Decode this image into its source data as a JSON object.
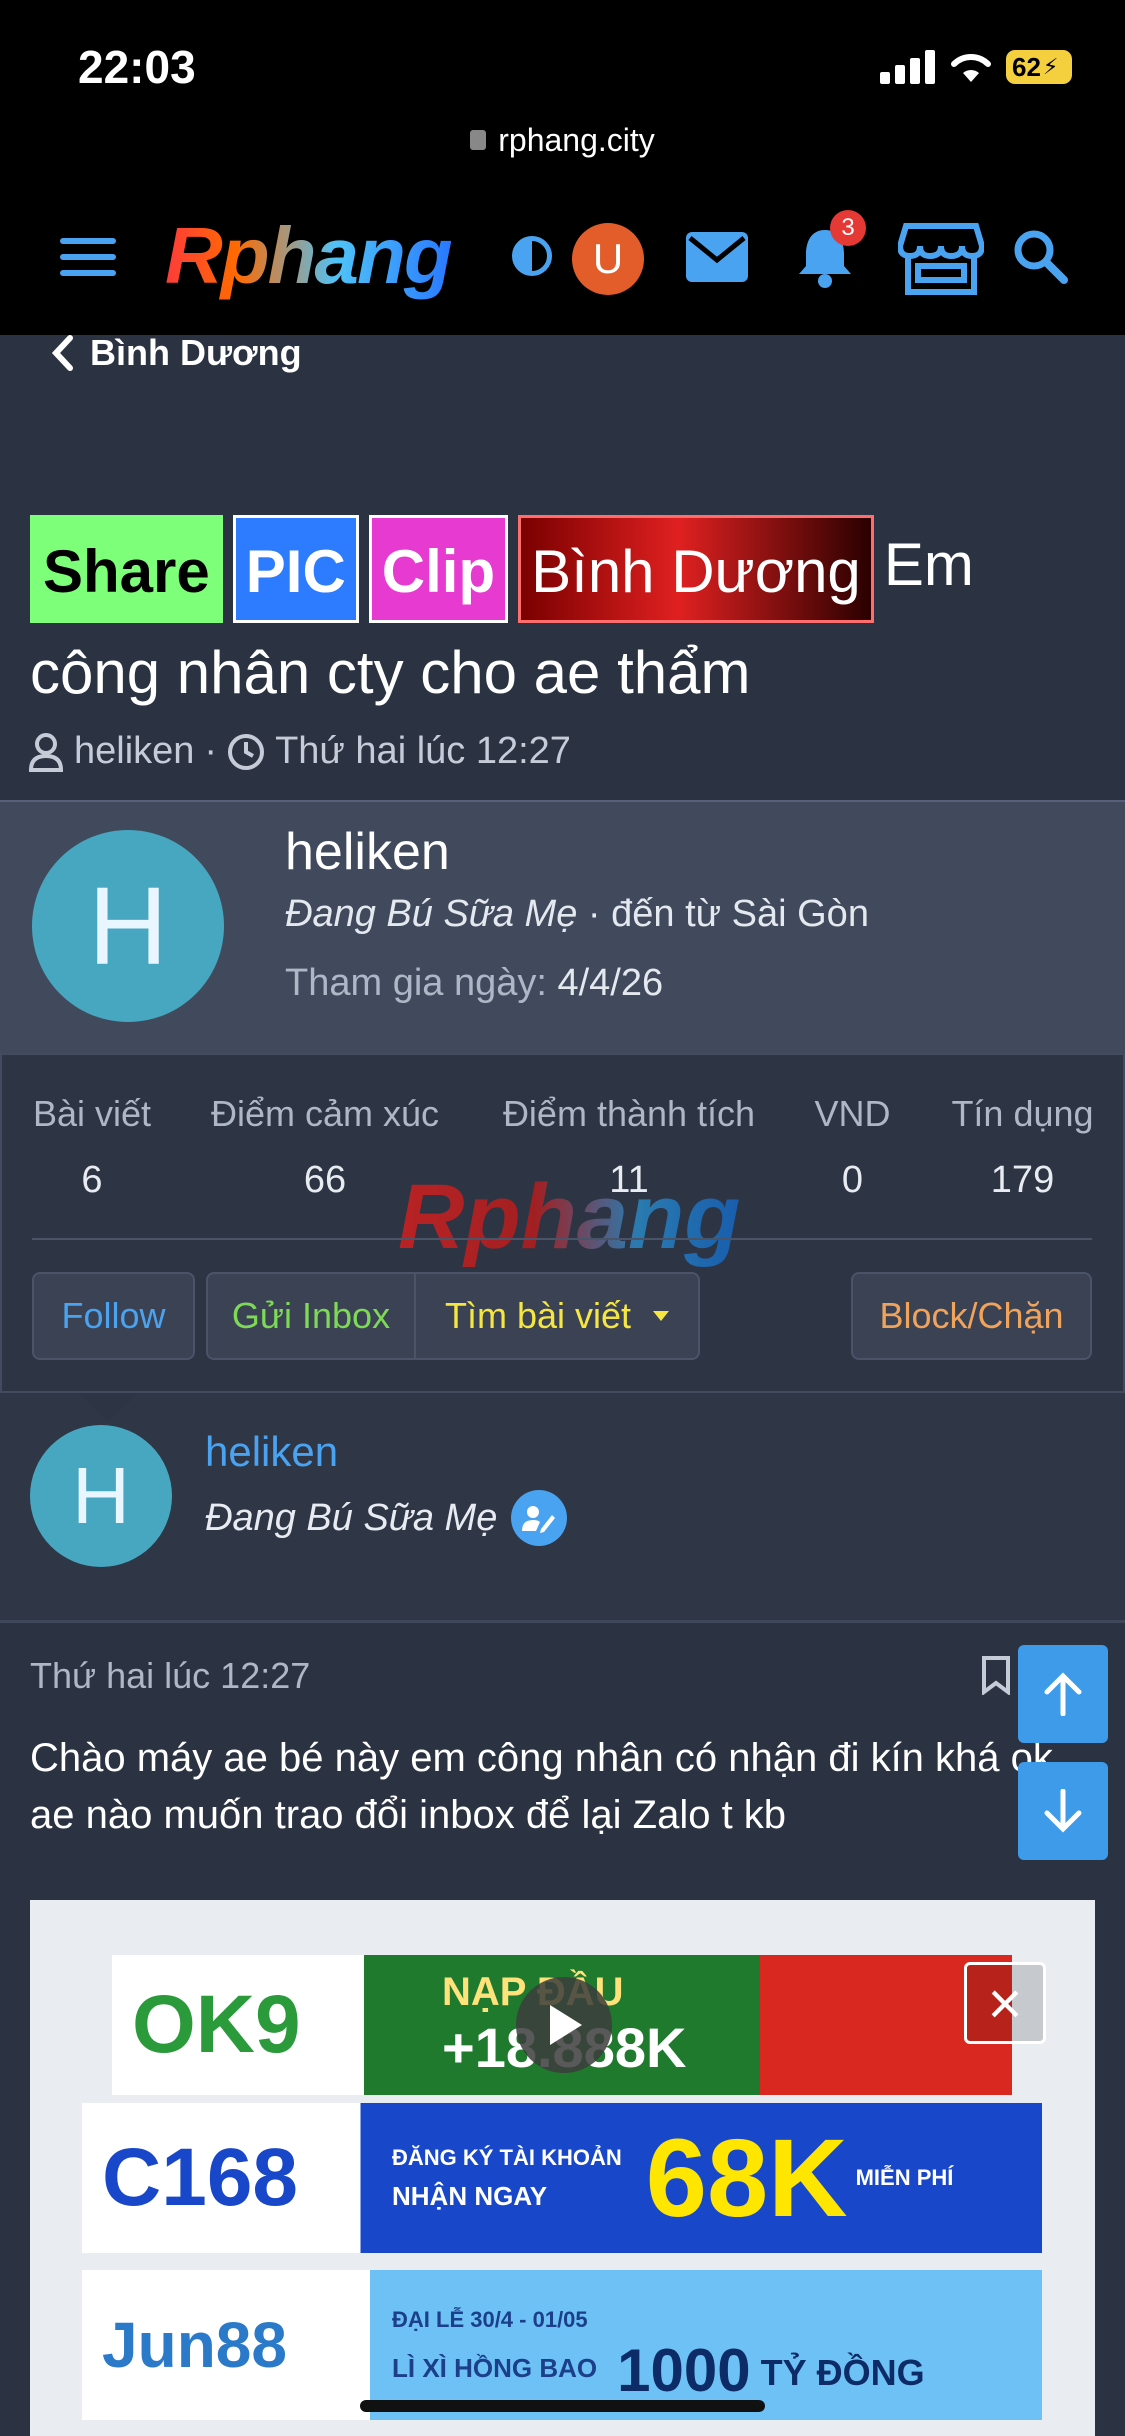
{
  "status_bar": {
    "time": "22:03",
    "battery": "62"
  },
  "browser": {
    "url": "rphang.city"
  },
  "header": {
    "logo": "Rphang",
    "user_initial": "U",
    "notification_count": "3"
  },
  "breadcrumb": {
    "label": "Bình Dương"
  },
  "thread": {
    "tags": [
      "Share",
      "PIC",
      "Clip",
      "Bình Dương"
    ],
    "title_rest": "Em công nhân cty cho ae thẩm",
    "author": "heliken",
    "separator": "·",
    "time": "Thứ hai lúc 12:27"
  },
  "profile": {
    "initial": "H",
    "name": "heliken",
    "rank": "Đang Bú Sữa Mẹ",
    "origin": "· đến từ Sài Gòn",
    "joined_label": "Tham gia ngày:",
    "joined_value": "4/4/26",
    "stats": [
      {
        "label": "Bài viết",
        "value": "6"
      },
      {
        "label": "Điểm cảm xúc",
        "value": "66"
      },
      {
        "label": "Điểm thành tích",
        "value": "11"
      },
      {
        "label": "VND",
        "value": "0"
      },
      {
        "label": "Tín dụng",
        "value": "179"
      }
    ],
    "watermark": "Rphang",
    "buttons": {
      "follow": "Follow",
      "inbox": "Gửi Inbox",
      "find_posts": "Tìm bài viết",
      "block": "Block/Chặn"
    }
  },
  "post": {
    "author_initial": "H",
    "author_name": "heliken",
    "author_rank": "Đang Bú Sữa Mẹ",
    "time": "Thứ hai lúc 12:27",
    "text": "Chào máy ae bé này em công nhân có nhận đi kín khá ok ae nào muốn trao đổi inbox để lại Zalo t kb"
  },
  "ads": {
    "ok9": {
      "brand": "OK9",
      "line1": "NẠP ĐẦU",
      "line2": "+18.888K"
    },
    "c168": {
      "brand": "C168",
      "line1": "ĐĂNG KÝ TÀI KHOẢN",
      "line2": "NHẬN NGAY",
      "amount": "68K",
      "extra": "MIỄN PHÍ"
    },
    "jun88": {
      "brand": "Jun88",
      "line1": "ĐẠI LỄ 30/4 - 01/05",
      "line2": "LÌ XÌ HỒNG BAO",
      "amount": "1000",
      "unit": "TỶ ĐỒNG"
    }
  },
  "colors": {
    "accent": "#4aa3f0",
    "badge": "#e53935",
    "follow": "#4aa3f0",
    "inbox": "#7ed957",
    "find": "#f5e642",
    "block": "#f0a35a"
  }
}
